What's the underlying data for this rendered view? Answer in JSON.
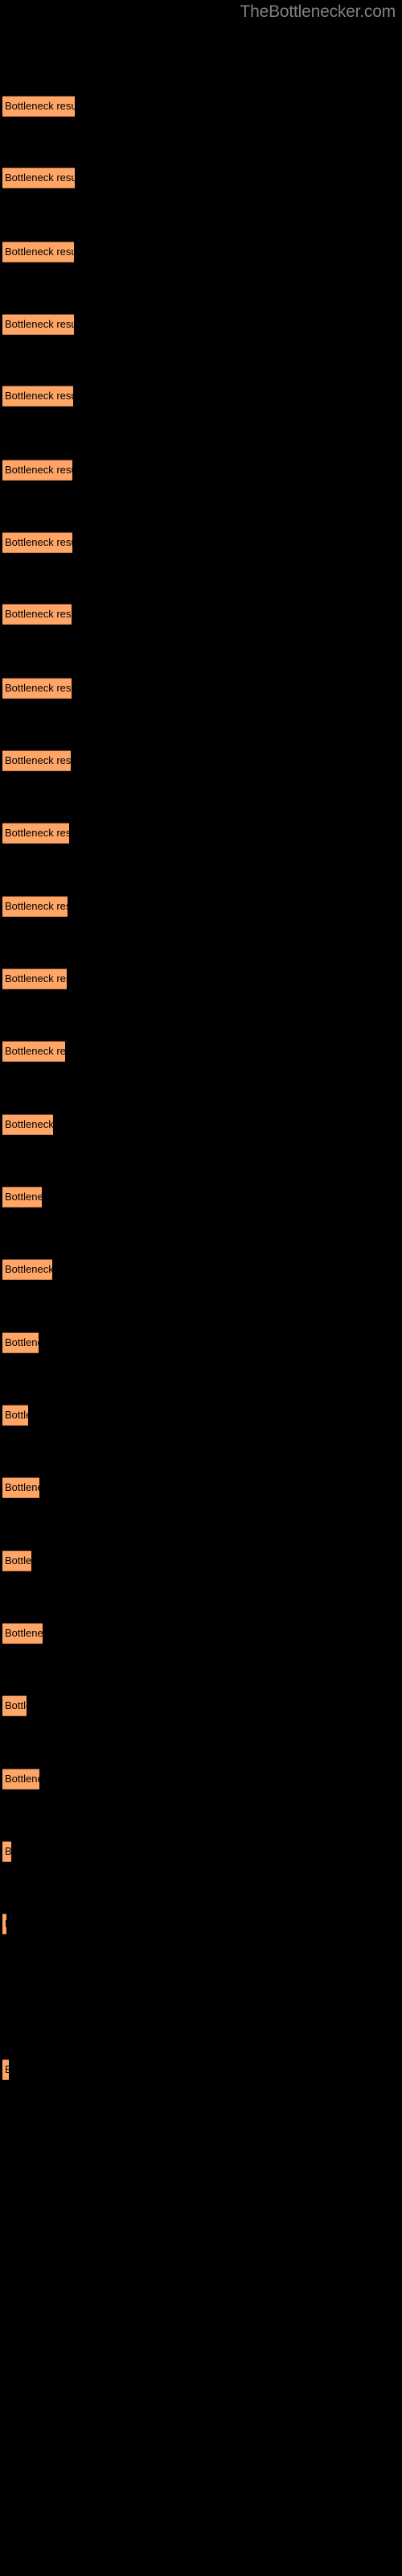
{
  "site": {
    "title": "TheBottlenecker.com",
    "title_color": "#808080"
  },
  "theme": {
    "background": "#000000",
    "bar_fill": "#FFA666",
    "bar_edge_top": "#6b4226",
    "bar_edge_bottom": "#c97f47",
    "label_color": "#000000"
  },
  "chart_data": {
    "type": "bar",
    "orientation": "horizontal",
    "title": "TheBottlenecker.com",
    "xlabel": "",
    "ylabel": "",
    "grid": false,
    "legend": null,
    "bar_label_text": "Bottleneck result",
    "categories": [
      "Bottleneck result",
      "Bottleneck result",
      "Bottleneck result",
      "Bottleneck result",
      "Bottleneck result",
      "Bottleneck result",
      "Bottleneck result",
      "Bottleneck result",
      "Bottleneck result",
      "Bottleneck result",
      "Bottleneck result",
      "Bottleneck result",
      "Bottleneck result",
      "Bottleneck result",
      "Bottleneck result",
      "Bottleneck result",
      "Bottleneck result",
      "Bottleneck result",
      "Bottleneck result",
      "Bottleneck result",
      "Bottleneck result",
      "Bottleneck result",
      "Bottleneck result",
      "Bottleneck result",
      "Bottleneck result",
      "Bottleneck result",
      "Bottleneck result",
      "Bottleneck result"
    ],
    "values": [
      90,
      90,
      89,
      89,
      88,
      87,
      87,
      86,
      86,
      85,
      83,
      81,
      80,
      78,
      63,
      49,
      62,
      45,
      32,
      46,
      36,
      50,
      30,
      46,
      11,
      5,
      0,
      8
    ],
    "xlim": [
      0,
      500
    ],
    "ylim": null
  },
  "bars": [
    {
      "y": 57,
      "width": 90,
      "label": "Bottleneck result"
    },
    {
      "y": 100,
      "width": 90,
      "label": "Bottleneck result"
    },
    {
      "y": 144,
      "width": 89,
      "label": "Bottleneck result"
    },
    {
      "y": 187,
      "width": 89,
      "label": "Bottleneck result"
    },
    {
      "y": 230,
      "width": 88,
      "label": "Bottleneck result"
    },
    {
      "y": 274,
      "width": 87,
      "label": "Bottleneck result"
    },
    {
      "y": 317,
      "width": 87,
      "label": "Bottleneck result"
    },
    {
      "y": 360,
      "width": 86,
      "label": "Bottleneck result"
    },
    {
      "y": 404,
      "width": 86,
      "label": "Bottleneck result"
    },
    {
      "y": 447,
      "width": 85,
      "label": "Bottleneck result"
    },
    {
      "y": 490,
      "width": 83,
      "label": "Bottleneck result"
    },
    {
      "y": 534,
      "width": 81,
      "label": "Bottleneck result"
    },
    {
      "y": 577,
      "width": 80,
      "label": "Bottleneck result"
    },
    {
      "y": 620,
      "width": 78,
      "label": "Bottleneck result"
    },
    {
      "y": 664,
      "width": 63,
      "label": "Bottleneck result"
    },
    {
      "y": 707,
      "width": 49,
      "label": "Bottleneck result"
    },
    {
      "y": 750,
      "width": 62,
      "label": "Bottleneck result"
    },
    {
      "y": 794,
      "width": 45,
      "label": "Bottleneck result"
    },
    {
      "y": 837,
      "width": 32,
      "label": "Bottleneck result"
    },
    {
      "y": 880,
      "width": 46,
      "label": "Bottleneck result"
    },
    {
      "y": 924,
      "width": 36,
      "label": "Bottleneck result"
    },
    {
      "y": 967,
      "width": 50,
      "label": "Bottleneck result"
    },
    {
      "y": 1010,
      "width": 30,
      "label": "Bottleneck result"
    },
    {
      "y": 1054,
      "width": 46,
      "label": "Bottleneck result"
    },
    {
      "y": 1097,
      "width": 11,
      "label": "Bottleneck result"
    },
    {
      "y": 1140,
      "width": 5,
      "label": "Bottleneck result"
    },
    {
      "y": 1184,
      "width": 0,
      "label": "Bottleneck result"
    },
    {
      "y": 1227,
      "width": 8,
      "label": "Bottleneck result"
    }
  ]
}
